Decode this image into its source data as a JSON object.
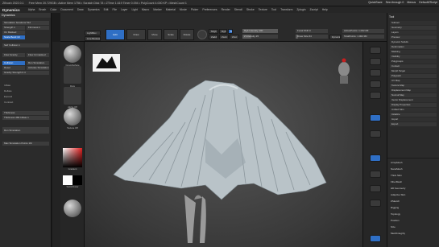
{
  "titlebar": {
    "title": "ZBrush 2022.0.1",
    "info": "Free Mem 20.729GB • Active Mem 1756 • Scratch Disk 78 • ZTime 1.619 Timer 0.094 • PolyCount 4.000 KP • MeshCount 1",
    "right_items": [
      "QuickSave",
      "See-through 0",
      "Menus",
      "DefaultZScript"
    ]
  },
  "menubar": {
    "app": "Dynamics",
    "items": [
      "Alpha",
      "Brush",
      "Color",
      "Document",
      "Draw",
      "Dynamics",
      "Edit",
      "File",
      "Layer",
      "Light",
      "Macro",
      "Marker",
      "Material",
      "Movie",
      "Picker",
      "Preferences",
      "Render",
      "Stencil",
      "Stroke",
      "Texture",
      "Tool",
      "Transform",
      "Zplugin",
      "Zscript",
      "Help"
    ]
  },
  "toolbar": {
    "mode_buttons": [
      "LightBox",
      "Live Boolean"
    ],
    "edit": "Edit",
    "draw": "Draw",
    "move": "Move",
    "scale": "Scale",
    "rotate": "Rotate",
    "mrgb": "Mrgb",
    "rgb": "Rgb",
    "m": "M",
    "zadd": "Zadd",
    "zsub": "Zsub",
    "zcut": "Zcut",
    "rgb_intensity": "Rgb Intensity 100",
    "z_intensity": "Z Intensity 25",
    "focal_shift": "Focal Shift 0",
    "draw_size": "Draw Size 64",
    "dynamic": "Dynamic",
    "active_points": "ActivePoints: 1.002 Mil",
    "total_points": "TotalPoints: 1.002 Mil",
    "rgb_intensity_value": 100,
    "z_intensity_value": 25,
    "draw_size_value": 64
  },
  "left_panel": {
    "header": "Dynamics",
    "rows": [
      {
        "label": "Simulation Iterations 512"
      },
      {
        "label": "Strength 1"
      },
      {
        "label": "Firmness 1"
      },
      {
        "label": "On Masked"
      },
      {
        "label": "Scale Bend 10"
      },
      {
        "label": "Self Collision 1"
      },
      {
        "label": "Max Folds"
      },
      {
        "label": "Max Steps 800"
      },
      {
        "label": "Flow Gravity"
      },
      {
        "label": "Flow Unmasked"
      },
      {
        "label": "Collision"
      },
      {
        "label": "Run Simulation"
      },
      {
        "label": "Reset"
      },
      {
        "label": "Activate Simulation"
      },
      {
        "label": "Gravity Strength 0.4"
      },
      {
        "label": "Inflate"
      },
      {
        "label": "Deflate"
      },
      {
        "label": "Expand"
      },
      {
        "label": "Contract"
      },
      {
        "label": "Thickness"
      },
      {
        "label": "Thickness 280 Inflate 1"
      },
      {
        "label": "Run Simulation"
      },
      {
        "label": "Max Simulation Points 1M"
      }
    ]
  },
  "tool_column": {
    "items": [
      {
        "label": "CurveSurface"
      },
      {
        "label": "Dots"
      },
      {
        "label": "Alpha Off"
      },
      {
        "label": "Texture Off"
      },
      {
        "label": "Gradient"
      },
      {
        "label": "SwitchColor"
      }
    ]
  },
  "canvas": {
    "logo_alt": "ZBrush logo"
  },
  "right_panel": {
    "header": "Tool",
    "sections": [
      {
        "label": "Subtool"
      },
      {
        "label": "Geometry"
      },
      {
        "label": "Layers"
      },
      {
        "label": "Preview"
      },
      {
        "label": "Dynamic Subdiv"
      },
      {
        "label": "Deformation"
      },
      {
        "label": "Masking"
      },
      {
        "label": "Visibility"
      },
      {
        "label": "Polygroups"
      },
      {
        "label": "Contact"
      },
      {
        "label": "Morph Target"
      },
      {
        "label": "Polypaint"
      },
      {
        "label": "UV Map"
      },
      {
        "label": "Texture Map"
      },
      {
        "label": "Displacement Map"
      },
      {
        "label": "Normal Map"
      },
      {
        "label": "Vector Displacement"
      },
      {
        "label": "Display Properties"
      },
      {
        "label": "Unified Skin"
      },
      {
        "label": "Initialize"
      },
      {
        "label": "Import"
      },
      {
        "label": "Export"
      }
    ],
    "bottom": [
      "ArrayMesh",
      "NanoMesh",
      "Thick Skin",
      "FiberMesh",
      "HD Geometry",
      "Adaptive Skin",
      "ZSketch",
      "Rigging",
      "Topology",
      "Position",
      "Size",
      "MeshIntegrity"
    ]
  },
  "colors": {
    "accent": "#2f6fc5",
    "panel": "#2a2a2a",
    "canvas": "#4a4a4a",
    "cloth": "#b9c3c8"
  }
}
